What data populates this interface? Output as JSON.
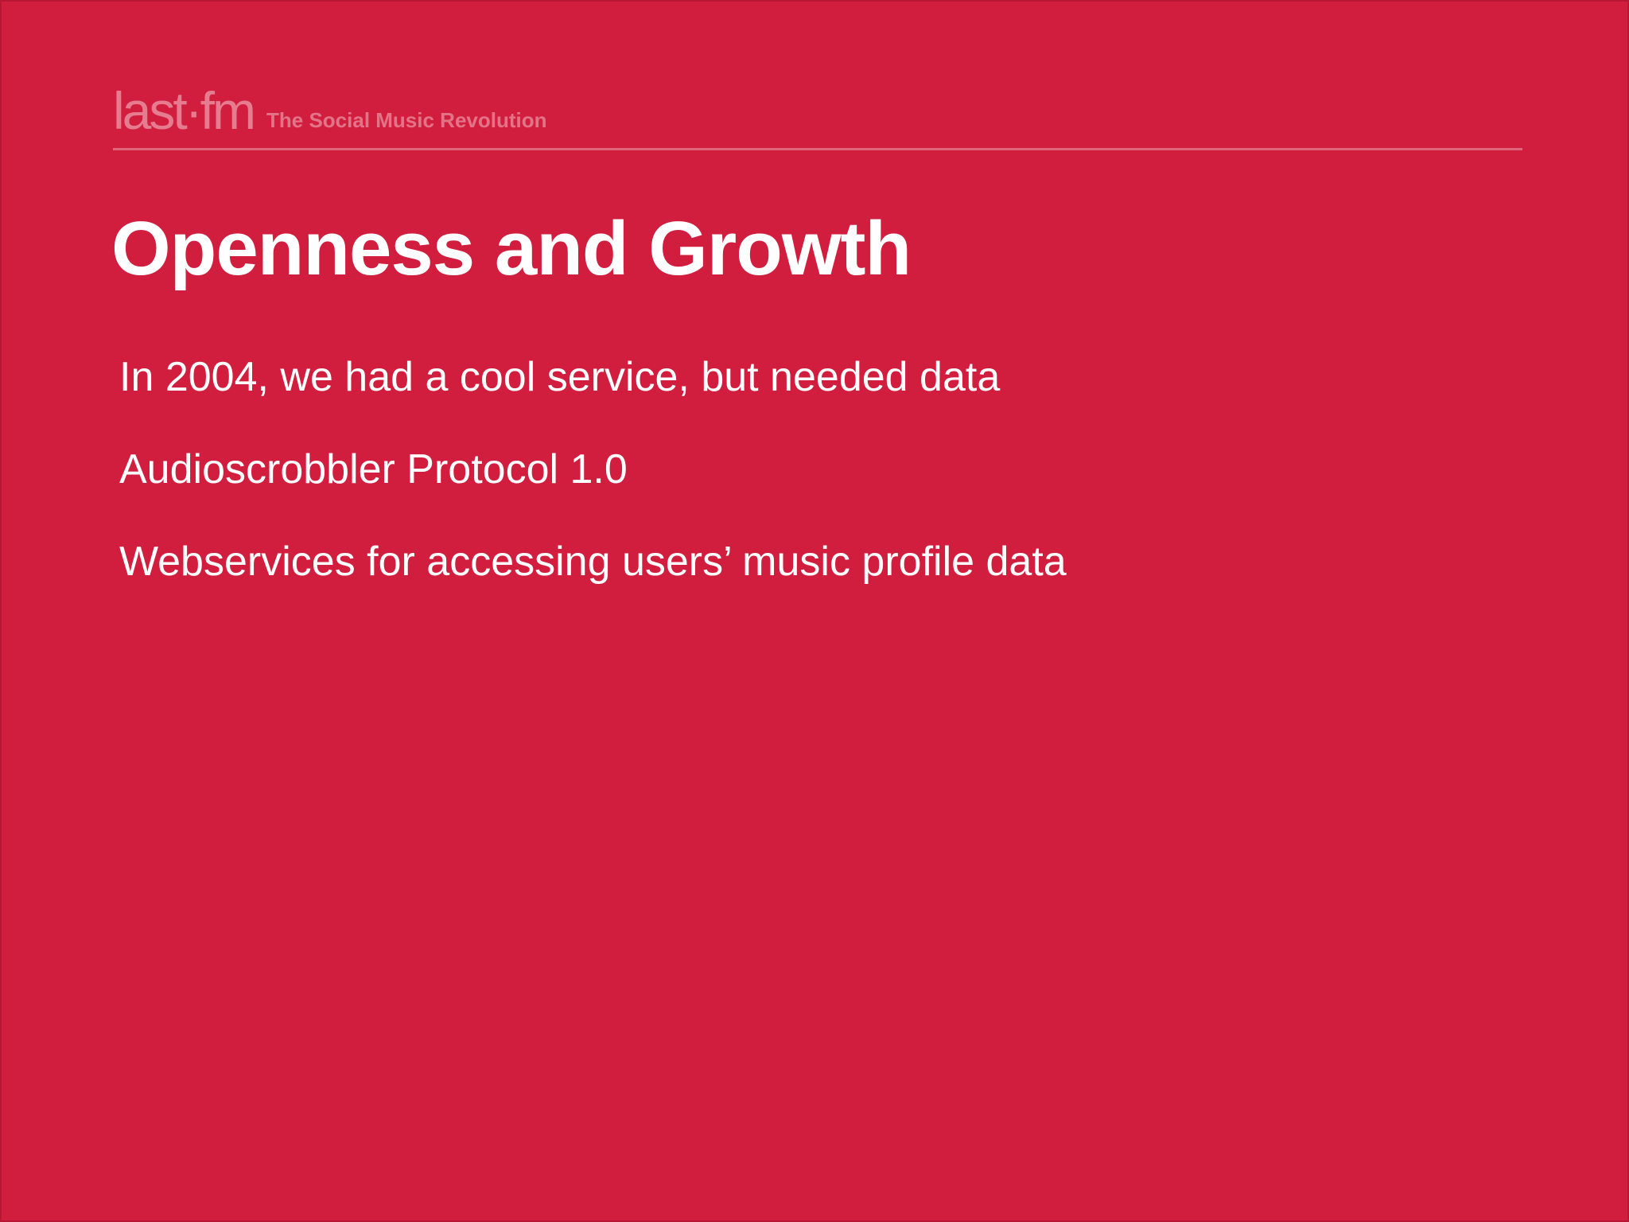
{
  "header": {
    "logo": "last·fm",
    "tagline": "The Social Music Revolution"
  },
  "slide": {
    "title": "Openness and Growth",
    "bullets": [
      "In 2004, we had a cool service, but needed data",
      "Audioscrobbler Protocol 1.0",
      "Webservices for accessing users’ music profile data"
    ]
  },
  "colors": {
    "background": "#d21e3e",
    "text": "#ffffff"
  }
}
